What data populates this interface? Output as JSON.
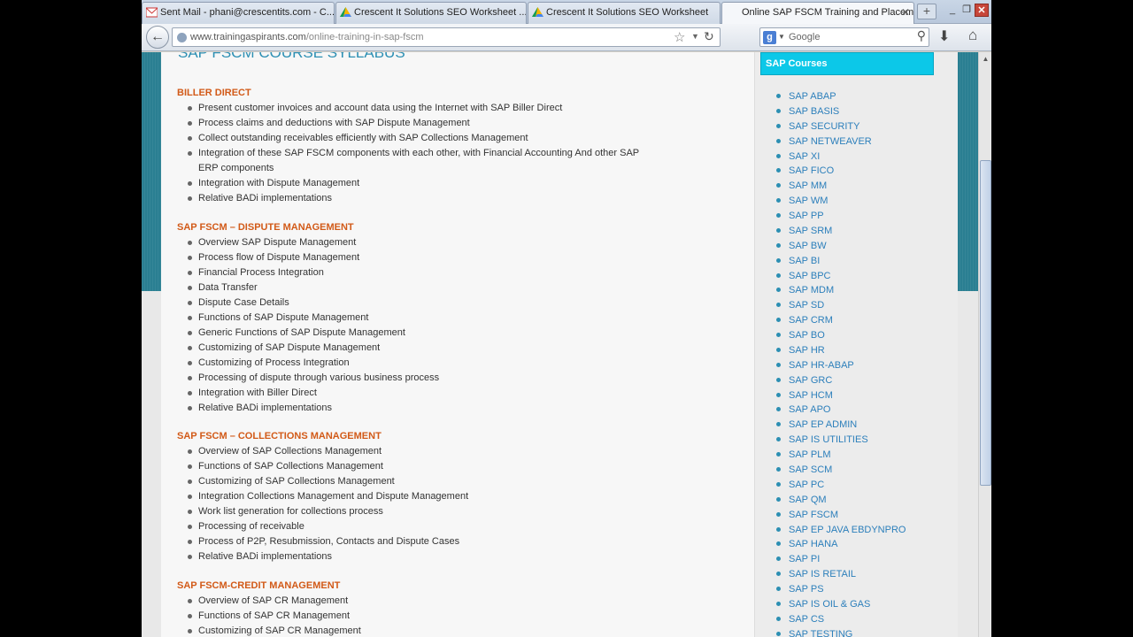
{
  "tabs": [
    {
      "label": "Sent Mail - phani@crescentits.com - C..."
    },
    {
      "label": "Crescent It Solutions SEO Worksheet ..."
    },
    {
      "label": "Crescent It Solutions SEO Worksheet"
    },
    {
      "label": "Online SAP FSCM Training and Placem..."
    }
  ],
  "new_tab_label": "+",
  "window_buttons": {
    "minimize": "_",
    "restore": "❐",
    "close": "✕"
  },
  "address": {
    "host": "www.trainingaspirants.com",
    "path": "/online-training-in-sap-fscm"
  },
  "search": {
    "engine_label": "g",
    "placeholder": "Google"
  },
  "page": {
    "heading": "SAP FSCM COURSE SYLLABUS",
    "sections": [
      {
        "title": "BILLER DIRECT",
        "items": [
          "Present customer invoices and account data using the Internet with SAP Biller Direct",
          "Process claims and deductions with SAP Dispute Management",
          "Collect outstanding receivables efficiently with SAP Collections Management",
          "Integration of these SAP FSCM components with each other, with Financial Accounting And other SAP ERP components",
          "Integration with Dispute Management",
          "Relative BADi implementations"
        ]
      },
      {
        "title": "SAP FSCM – DISPUTE MANAGEMENT",
        "items": [
          "Overview SAP Dispute Management",
          "Process flow of Dispute Management",
          "Financial Process Integration",
          "Data Transfer",
          "Dispute Case Details",
          "Functions of SAP Dispute Management",
          "Generic Functions of SAP Dispute Management",
          "Customizing of SAP Dispute Management",
          "Customizing of Process Integration",
          "Processing of dispute through various business process",
          "Integration with Biller Direct",
          "Relative BADi implementations"
        ]
      },
      {
        "title": "SAP FSCM – COLLECTIONS MANAGEMENT",
        "items": [
          "Overview of SAP Collections Management",
          "Functions of SAP Collections Management",
          "Customizing of SAP Collections Management",
          "Integration Collections Management and Dispute Management",
          "Work list generation for collections process",
          "Processing of receivable",
          "Process of P2P, Resubmission, Contacts and Dispute Cases",
          "Relative BADi implementations"
        ]
      },
      {
        "title": "SAP FSCM-CREDIT MANAGEMENT",
        "items": [
          "Overview of SAP CR Management",
          "Functions of SAP CR Management",
          "Customizing of SAP CR Management"
        ]
      }
    ]
  },
  "sidebar": {
    "title": "SAP Courses",
    "courses": [
      "SAP ABAP",
      "SAP BASIS",
      "SAP SECURITY",
      "SAP NETWEAVER",
      "SAP XI",
      "SAP FICO",
      "SAP MM",
      "SAP WM",
      "SAP PP",
      "SAP SRM",
      "SAP BW",
      "SAP BI",
      "SAP BPC",
      "SAP MDM",
      "SAP SD",
      "SAP CRM",
      "SAP BO",
      "SAP HR",
      "SAP HR-ABAP",
      "SAP GRC",
      "SAP HCM",
      "SAP APO",
      "SAP EP ADMIN",
      "SAP IS UTILITIES",
      "SAP PLM",
      "SAP SCM",
      "SAP PC",
      "SAP QM",
      "SAP FSCM",
      "SAP EP JAVA EBDYNPRO",
      "SAP HANA",
      "SAP PI",
      "SAP IS RETAIL",
      "SAP PS",
      "SAP IS OIL & GAS",
      "SAP CS",
      "SAP TESTING"
    ]
  },
  "colors": {
    "section_title": "#d25a18",
    "link": "#2c7fbb",
    "sidebar_header_bg": "#0cc8e8",
    "teal_band": "#2a7f92"
  }
}
